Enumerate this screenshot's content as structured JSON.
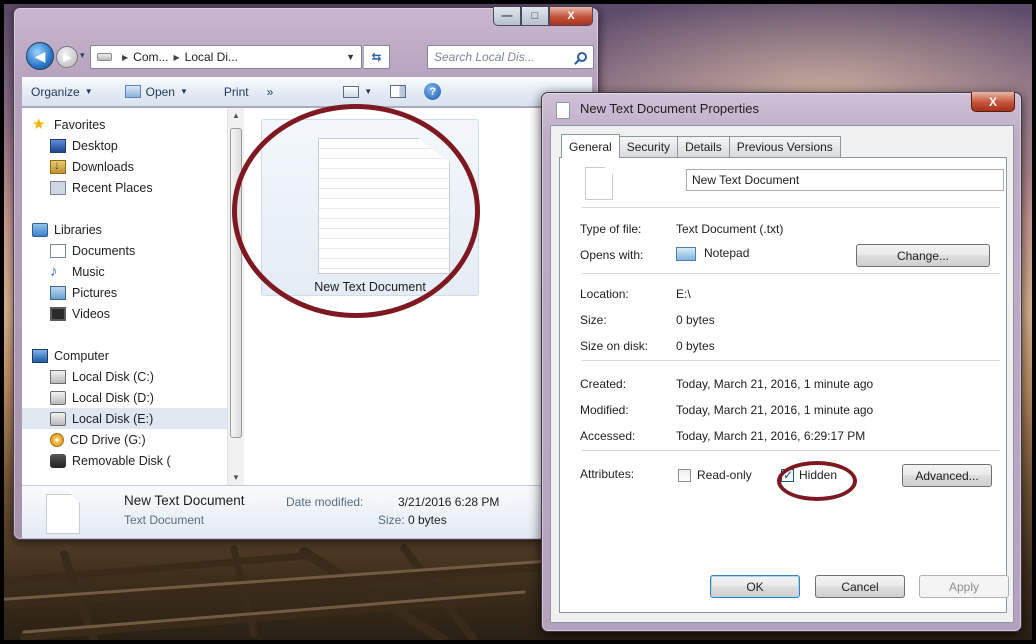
{
  "explorer": {
    "window_controls": {
      "minimize": "—",
      "maximize": "□",
      "close": "X"
    },
    "nav": {
      "back_glyph": "◀",
      "forward_glyph": "▶"
    },
    "address": {
      "crumbs": [
        "Com...",
        "Local Di..."
      ]
    },
    "search": {
      "placeholder": "Search Local Dis..."
    },
    "toolbar": {
      "organize": "Organize",
      "open": "Open",
      "print": "Print",
      "more": "»",
      "help": "?"
    },
    "nav_pane": {
      "favorites": {
        "label": "Favorites",
        "items": [
          "Desktop",
          "Downloads",
          "Recent Places"
        ]
      },
      "libraries": {
        "label": "Libraries",
        "items": [
          "Documents",
          "Music",
          "Pictures",
          "Videos"
        ]
      },
      "computer": {
        "label": "Computer",
        "items": [
          "Local Disk (C:)",
          "Local Disk (D:)",
          "Local Disk (E:)",
          "CD Drive (G:)",
          "Removable Disk ("
        ]
      },
      "selected": "Local Disk (E:)"
    },
    "file_tile": {
      "name": "New Text Document"
    },
    "details": {
      "name": "New Text Document",
      "type": "Text Document",
      "date_modified_label": "Date modified:",
      "date_modified": "3/21/2016 6:28 PM",
      "size_label": "Size:",
      "size": "0 bytes"
    }
  },
  "dialog": {
    "title": "New Text Document Properties",
    "close": "X",
    "tabs": [
      "General",
      "Security",
      "Details",
      "Previous Versions"
    ],
    "active_tab": "General",
    "file_name": "New Text Document",
    "type_of_file_label": "Type of file:",
    "type_of_file": "Text Document (.txt)",
    "opens_with_label": "Opens with:",
    "opens_with": "Notepad",
    "change_button": "Change...",
    "location_label": "Location:",
    "location": "E:\\",
    "size_label": "Size:",
    "size": "0 bytes",
    "size_on_disk_label": "Size on disk:",
    "size_on_disk": "0 bytes",
    "created_label": "Created:",
    "created": "Today, March 21, 2016, 1 minute ago",
    "modified_label": "Modified:",
    "modified": "Today, March 21, 2016, 1 minute ago",
    "accessed_label": "Accessed:",
    "accessed": "Today, March 21, 2016, 6:29:17 PM",
    "attributes_label": "Attributes:",
    "read_only_label": "Read-only",
    "read_only_checked": false,
    "hidden_label": "Hidden",
    "hidden_checked": true,
    "advanced_button": "Advanced...",
    "ok_button": "OK",
    "cancel_button": "Cancel",
    "apply_button": "Apply"
  },
  "annotations": {
    "ring_color": "#7f1921"
  }
}
